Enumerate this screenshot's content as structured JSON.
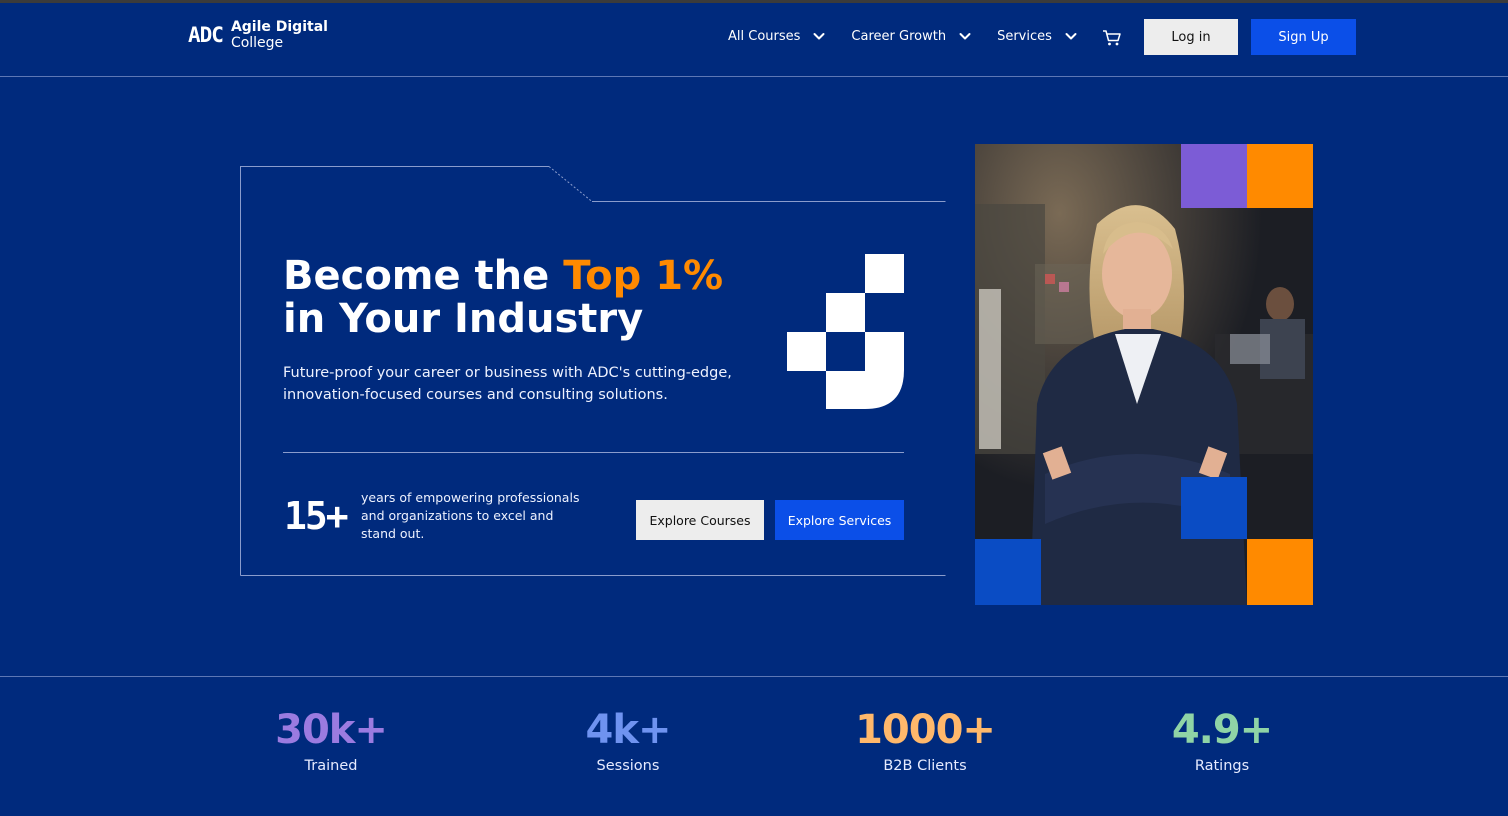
{
  "brand": {
    "mark": "ADC",
    "name_line1": "Agile Digital",
    "name_line2": "College"
  },
  "nav": {
    "items": [
      {
        "label": "All Courses"
      },
      {
        "label": "Career Growth"
      },
      {
        "label": "Services"
      }
    ],
    "login_label": "Log in",
    "signup_label": "Sign Up"
  },
  "hero": {
    "headline_pre": "Become the ",
    "headline_accent": "Top 1%",
    "headline_post": " in Your Industry",
    "subtext": "Future-proof your career or business with ADC's cutting-edge, innovation-focused courses and consulting solutions.",
    "years_value": "15+",
    "years_text": "years of empowering professionals and organizations to excel and stand out.",
    "explore_courses_label": "Explore Courses",
    "explore_services_label": "Explore Services"
  },
  "stats": [
    {
      "value": "30k+",
      "label": "Trained",
      "color": "#9b7be0"
    },
    {
      "value": "4k+",
      "label": "Sessions",
      "color": "#6f93f0"
    },
    {
      "value": "1000+",
      "label": "B2B Clients",
      "color": "#ffb86b"
    },
    {
      "value": "4.9+",
      "label": "Ratings",
      "color": "#8fd4a6"
    }
  ],
  "colors": {
    "background": "#002a7d",
    "accent_orange": "#ff8a00",
    "primary_blue": "#0b4fe8",
    "purple_tile": "#7c5cd6",
    "blue_tile": "#0a4cc4"
  },
  "icons": [
    "chevron-down-icon",
    "cart-icon",
    "adc-logo",
    "pixel-j-graphic"
  ]
}
